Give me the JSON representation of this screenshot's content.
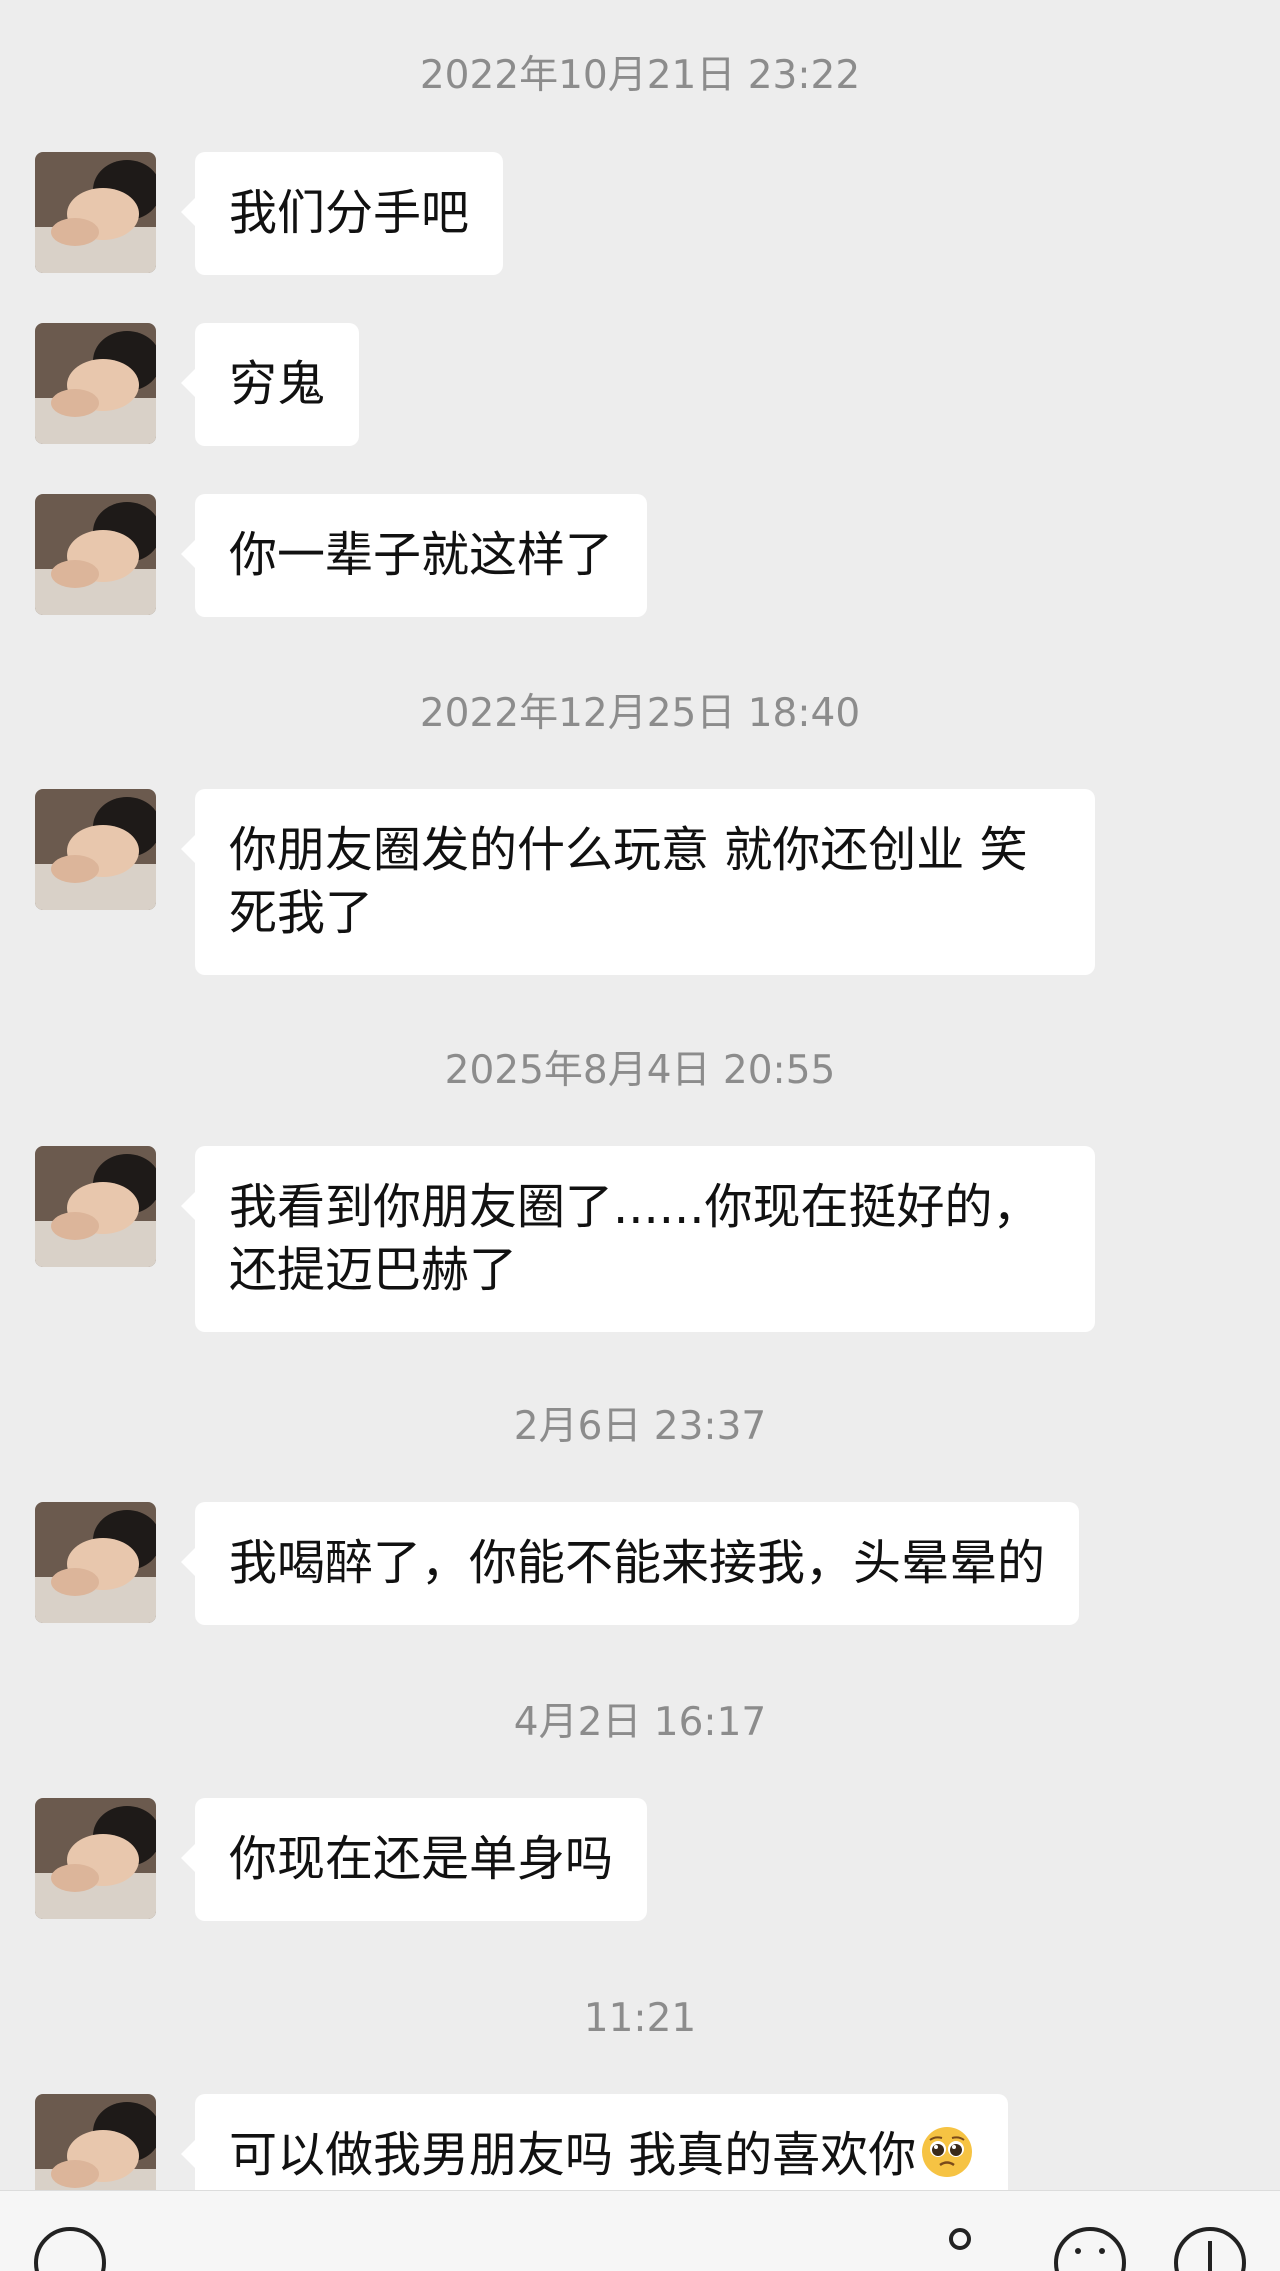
{
  "messages": [
    {
      "timestamp": "2022年10月21日 23:22"
    },
    {
      "text": "我们分手吧"
    },
    {
      "text": "穷鬼"
    },
    {
      "text": "你一辈子就这样了"
    },
    {
      "timestamp": "2022年12月25日 18:40"
    },
    {
      "text": "你朋友圈发的什么玩意 就你还创业 笑死我了"
    },
    {
      "timestamp": "2025年8月4日 20:55"
    },
    {
      "text": "我看到你朋友圈了......你现在挺好的，还提迈巴赫了"
    },
    {
      "timestamp": "2月6日 23:37"
    },
    {
      "text": "我喝醉了，你能不能来接我，头晕晕的"
    },
    {
      "timestamp": "4月2日 16:17"
    },
    {
      "text": "你现在还是单身吗"
    },
    {
      "timestamp": "11:21"
    },
    {
      "text": "可以做我男朋友吗 我真的喜欢你",
      "emoji": "pleading-face-emoji"
    }
  ],
  "input_bar": {
    "icons": [
      "voice-icon",
      "emoji-icon",
      "add-icon"
    ]
  },
  "colors": {
    "background": "#ededed",
    "bubble": "#ffffff",
    "timestamp_text": "#8c8c8c"
  }
}
